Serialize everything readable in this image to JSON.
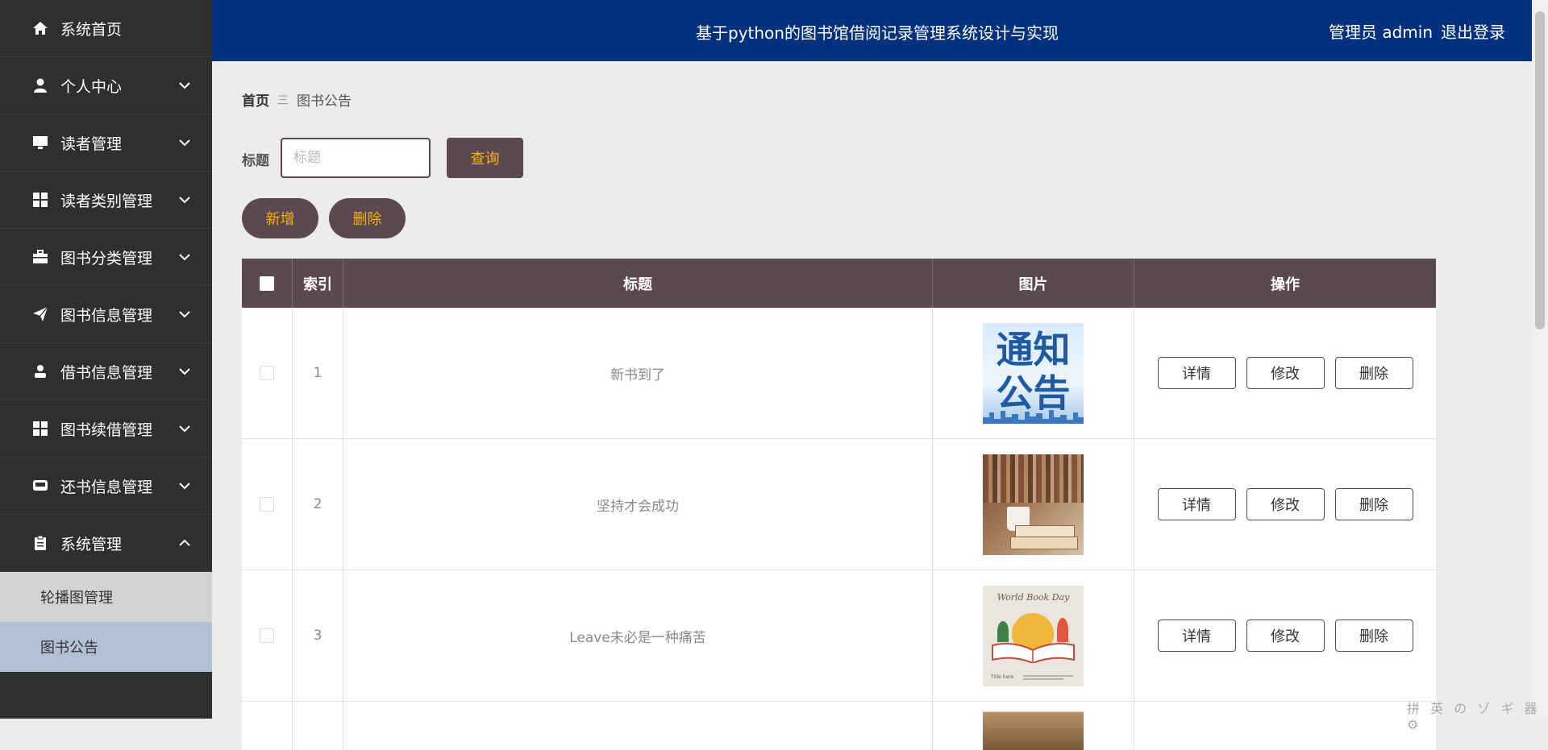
{
  "header": {
    "title": "基于python的图书馆借阅记录管理系统设计与实现",
    "user": "管理员 admin",
    "logout": "退出登录"
  },
  "sidebar": {
    "items": [
      {
        "label": "系统首页",
        "icon": "home-icon"
      },
      {
        "label": "个人中心",
        "icon": "user-icon"
      },
      {
        "label": "读者管理",
        "icon": "monitor-icon"
      },
      {
        "label": "读者类别管理",
        "icon": "grid-icon"
      },
      {
        "label": "图书分类管理",
        "icon": "briefcase-icon"
      },
      {
        "label": "图书信息管理",
        "icon": "paper-plane-icon"
      },
      {
        "label": "借书信息管理",
        "icon": "person-icon"
      },
      {
        "label": "图书续借管理",
        "icon": "grid-icon"
      },
      {
        "label": "还书信息管理",
        "icon": "inbox-icon"
      },
      {
        "label": "系统管理",
        "icon": "clipboard-icon"
      }
    ],
    "subitems": [
      {
        "label": "轮播图管理"
      },
      {
        "label": "图书公告"
      }
    ]
  },
  "breadcrumb": {
    "home": "首页",
    "separator": "三",
    "current": "图书公告"
  },
  "search": {
    "label": "标题",
    "placeholder": "标题",
    "value": "",
    "button": "查询"
  },
  "actions": {
    "add": "新增",
    "delete": "删除"
  },
  "table": {
    "headers": [
      "索引",
      "标题",
      "图片",
      "操作"
    ],
    "rows": [
      {
        "index": "1",
        "title": "新书到了",
        "image": "notice-image",
        "image_text": [
          "通知",
          "公告"
        ]
      },
      {
        "index": "2",
        "title": "坚持才会成功",
        "image": "books-coffee-image"
      },
      {
        "index": "3",
        "title": "Leave未必是一种痛苦",
        "image": "world-book-day-image",
        "image_text": [
          "World Book Day",
          "Title here"
        ]
      }
    ],
    "row_actions": {
      "detail": "详情",
      "edit": "修改",
      "delete": "删除"
    }
  },
  "colors": {
    "sidebar_bg": "#2f2f2f",
    "header_bg": "#04317d",
    "accent": "#5c4850",
    "button_text": "#f4b400",
    "active_sub": "#b3c0d4"
  },
  "ime": "拼 英 の ゾ ギ 器 ⚙"
}
